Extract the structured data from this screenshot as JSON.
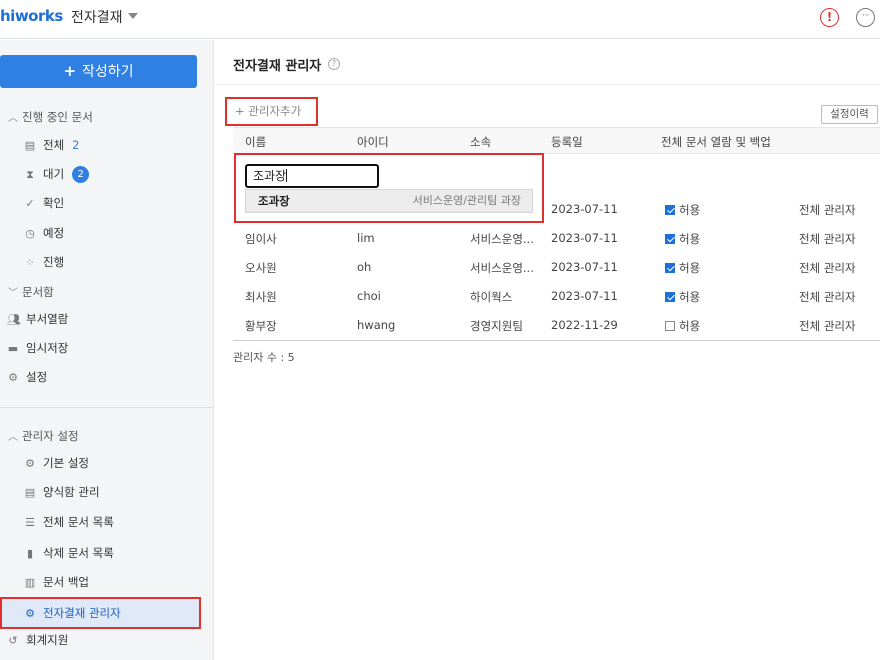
{
  "topbar": {
    "logo": "hiworks",
    "app_title": "전자결재",
    "alert_icon": "!",
    "more_icon": "···"
  },
  "sidebar": {
    "write_button": "작성하기",
    "in_progress": {
      "header": "진행 중인 문서",
      "items": [
        {
          "label": "전체",
          "count": "2",
          "icon": "document-icon"
        },
        {
          "label": "대기",
          "badge": "2",
          "icon": "hourglass-icon"
        },
        {
          "label": "확인",
          "icon": "check-icon"
        },
        {
          "label": "예정",
          "icon": "clock-icon"
        },
        {
          "label": "진행",
          "icon": "spinner-icon"
        }
      ]
    },
    "docbox": {
      "header": "문서함",
      "items": [
        {
          "label": "부서열람",
          "icon": "users-icon"
        },
        {
          "label": "임시저장",
          "icon": "tray-icon"
        },
        {
          "label": "설정",
          "icon": "gear-icon"
        }
      ]
    },
    "admin": {
      "header": "관리자 설정",
      "items": [
        {
          "label": "기본 설정",
          "icon": "gear-icon"
        },
        {
          "label": "양식함 관리",
          "icon": "document-icon"
        },
        {
          "label": "전체 문서 목록",
          "icon": "list-icon"
        },
        {
          "label": "삭제 문서 목록",
          "icon": "trash-icon"
        },
        {
          "label": "문서 백업",
          "icon": "backup-icon"
        },
        {
          "label": "전자결재 관리자",
          "icon": "user-gear-icon"
        }
      ]
    },
    "accounting": "회계지원"
  },
  "main": {
    "title": "전자결재 관리자",
    "help": "?",
    "add_admin": "+ 관리자추가",
    "history_button": "설정이력",
    "columns": [
      "이름",
      "아이디",
      "소속",
      "등록일",
      "전체 문서 열람 및 백업"
    ],
    "rows": [
      {
        "name": "",
        "id": "",
        "dept": "",
        "date": "2023-07-11",
        "allow": "허용",
        "checked": true,
        "role": "전체 관리자"
      },
      {
        "name": "임이사",
        "id": "lim",
        "dept": "서비스운영...",
        "date": "2023-07-11",
        "allow": "허용",
        "checked": true,
        "role": "전체 관리자"
      },
      {
        "name": "오사원",
        "id": "oh",
        "dept": "서비스운영...",
        "date": "2023-07-11",
        "allow": "허용",
        "checked": true,
        "role": "전체 관리자"
      },
      {
        "name": "최사원",
        "id": "choi",
        "dept": "하이웍스",
        "date": "2023-07-11",
        "allow": "허용",
        "checked": true,
        "role": "전체 관리자"
      },
      {
        "name": "황부장",
        "id": "hwang",
        "dept": "경영지원팀",
        "date": "2022-11-29",
        "allow": "허용",
        "checked": false,
        "role": "전체 관리자"
      }
    ],
    "admin_count": "관리자 수 : 5",
    "search": {
      "value": "조과장",
      "suggestion_name": "조과장",
      "suggestion_dept": "서비스운영/관리팀 과장"
    }
  },
  "colors": {
    "accent": "#2f80e2",
    "highlight_border": "#e03030",
    "sidebar_bg": "#f4f5f7"
  }
}
